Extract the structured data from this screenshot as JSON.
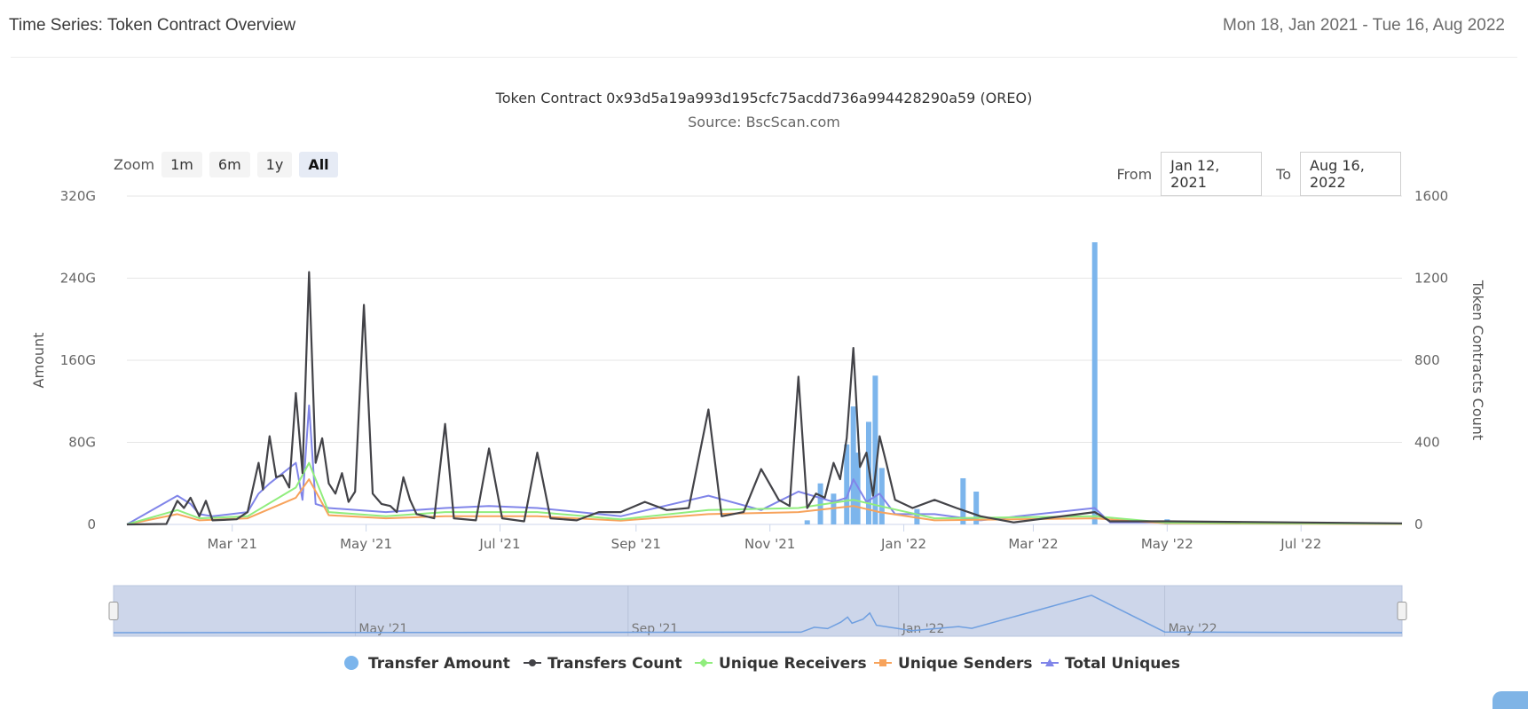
{
  "header": {
    "title": "Time Series: Token Contract Overview",
    "date_range": "Mon 18, Jan 2021 - Tue 16, Aug 2022"
  },
  "zoom": {
    "label": "Zoom",
    "buttons": [
      {
        "label": "1m",
        "active": false
      },
      {
        "label": "6m",
        "active": false
      },
      {
        "label": "1y",
        "active": false
      },
      {
        "label": "All",
        "active": true
      }
    ]
  },
  "range": {
    "from_label": "From",
    "from_value": "Jan 12, 2021",
    "to_label": "To",
    "to_value": "Aug 16, 2022"
  },
  "colors": {
    "transfer_amount": "#7cb5ec",
    "transfers_count": "#434348",
    "unique_receivers": "#90ed7d",
    "unique_senders": "#f7a35c",
    "total_uniques": "#8085e9",
    "navigator_fill": "#cdd6ea"
  },
  "chart_data": {
    "type": "line",
    "title": "Token Contract 0x93d5a19a993d195cfc75acdd736a994428290a59 (OREO)",
    "subtitle": "Source: BscScan.com",
    "x_range": [
      "2021-01-12",
      "2022-08-16"
    ],
    "y_left": {
      "label": "Amount",
      "ticks": [
        "0",
        "80G",
        "160G",
        "240G",
        "320G"
      ],
      "max": 320
    },
    "y_right": {
      "label": "Token Contracts Count",
      "ticks": [
        "0",
        "400",
        "800",
        "1200",
        "1600"
      ],
      "max": 1600
    },
    "x_ticks": [
      {
        "date": "2021-03-01",
        "label": "Mar '21"
      },
      {
        "date": "2021-05-01",
        "label": "May '21"
      },
      {
        "date": "2021-07-01",
        "label": "Jul '21"
      },
      {
        "date": "2021-09-01",
        "label": "Sep '21"
      },
      {
        "date": "2021-11-01",
        "label": "Nov '21"
      },
      {
        "date": "2022-01-01",
        "label": "Jan '22"
      },
      {
        "date": "2022-03-01",
        "label": "Mar '22"
      },
      {
        "date": "2022-05-01",
        "label": "May '22"
      },
      {
        "date": "2022-07-01",
        "label": "Jul '22"
      }
    ],
    "navigator_ticks": [
      {
        "date": "2021-05-01",
        "label": "May '21"
      },
      {
        "date": "2021-09-01",
        "label": "Sep '21"
      },
      {
        "date": "2022-01-01",
        "label": "Jan '22"
      },
      {
        "date": "2022-05-01",
        "label": "May '22"
      }
    ],
    "grid": true,
    "legend_position": "bottom-center",
    "series": [
      {
        "name": "Transfer Amount",
        "type": "column",
        "axis": "left",
        "unit": "G",
        "points": [
          [
            "2021-11-18",
            4
          ],
          [
            "2021-11-24",
            40
          ],
          [
            "2021-11-30",
            30
          ],
          [
            "2021-12-06",
            78
          ],
          [
            "2021-12-09",
            115
          ],
          [
            "2021-12-11",
            70
          ],
          [
            "2021-12-16",
            100
          ],
          [
            "2021-12-19",
            145
          ],
          [
            "2021-12-22",
            55
          ],
          [
            "2022-01-07",
            15
          ],
          [
            "2022-01-28",
            45
          ],
          [
            "2022-02-03",
            32
          ],
          [
            "2022-03-29",
            275
          ],
          [
            "2022-05-01",
            5
          ]
        ]
      },
      {
        "name": "Transfers Count",
        "type": "line",
        "axis": "right",
        "points": [
          [
            "2021-01-12",
            0
          ],
          [
            "2021-01-30",
            2
          ],
          [
            "2021-02-04",
            115
          ],
          [
            "2021-02-07",
            80
          ],
          [
            "2021-02-10",
            130
          ],
          [
            "2021-02-14",
            40
          ],
          [
            "2021-02-17",
            115
          ],
          [
            "2021-02-20",
            20
          ],
          [
            "2021-03-03",
            25
          ],
          [
            "2021-03-08",
            60
          ],
          [
            "2021-03-13",
            300
          ],
          [
            "2021-03-15",
            170
          ],
          [
            "2021-03-18",
            430
          ],
          [
            "2021-03-21",
            230
          ],
          [
            "2021-03-24",
            240
          ],
          [
            "2021-03-27",
            180
          ],
          [
            "2021-03-30",
            640
          ],
          [
            "2021-04-02",
            250
          ],
          [
            "2021-04-05",
            1230
          ],
          [
            "2021-04-08",
            300
          ],
          [
            "2021-04-11",
            420
          ],
          [
            "2021-04-14",
            200
          ],
          [
            "2021-04-17",
            150
          ],
          [
            "2021-04-20",
            250
          ],
          [
            "2021-04-23",
            110
          ],
          [
            "2021-04-26",
            160
          ],
          [
            "2021-04-30",
            1070
          ],
          [
            "2021-05-04",
            150
          ],
          [
            "2021-05-08",
            100
          ],
          [
            "2021-05-12",
            90
          ],
          [
            "2021-05-15",
            60
          ],
          [
            "2021-05-18",
            230
          ],
          [
            "2021-05-21",
            120
          ],
          [
            "2021-05-24",
            50
          ],
          [
            "2021-06-01",
            30
          ],
          [
            "2021-06-06",
            490
          ],
          [
            "2021-06-10",
            30
          ],
          [
            "2021-06-20",
            20
          ],
          [
            "2021-06-26",
            370
          ],
          [
            "2021-07-02",
            30
          ],
          [
            "2021-07-12",
            15
          ],
          [
            "2021-07-18",
            350
          ],
          [
            "2021-07-24",
            30
          ],
          [
            "2021-08-05",
            20
          ],
          [
            "2021-08-15",
            60
          ],
          [
            "2021-08-25",
            60
          ],
          [
            "2021-09-05",
            110
          ],
          [
            "2021-09-15",
            70
          ],
          [
            "2021-09-25",
            80
          ],
          [
            "2021-10-04",
            560
          ],
          [
            "2021-10-10",
            40
          ],
          [
            "2021-10-20",
            60
          ],
          [
            "2021-10-28",
            270
          ],
          [
            "2021-11-05",
            120
          ],
          [
            "2021-11-10",
            90
          ],
          [
            "2021-11-14",
            720
          ],
          [
            "2021-11-18",
            80
          ],
          [
            "2021-11-22",
            150
          ],
          [
            "2021-11-26",
            130
          ],
          [
            "2021-11-30",
            300
          ],
          [
            "2021-12-03",
            220
          ],
          [
            "2021-12-06",
            420
          ],
          [
            "2021-12-09",
            860
          ],
          [
            "2021-12-12",
            280
          ],
          [
            "2021-12-15",
            350
          ],
          [
            "2021-12-18",
            140
          ],
          [
            "2021-12-21",
            430
          ],
          [
            "2021-12-24",
            300
          ],
          [
            "2021-12-28",
            120
          ],
          [
            "2022-01-05",
            80
          ],
          [
            "2022-01-15",
            120
          ],
          [
            "2022-01-25",
            80
          ],
          [
            "2022-02-05",
            40
          ],
          [
            "2022-02-20",
            10
          ],
          [
            "2022-03-29",
            60
          ],
          [
            "2022-04-05",
            15
          ],
          [
            "2022-05-01",
            15
          ],
          [
            "2022-08-16",
            5
          ]
        ]
      },
      {
        "name": "Unique Receivers",
        "type": "line",
        "axis": "right",
        "points": [
          [
            "2021-01-12",
            0
          ],
          [
            "2021-02-04",
            70
          ],
          [
            "2021-02-14",
            30
          ],
          [
            "2021-03-08",
            40
          ],
          [
            "2021-03-30",
            180
          ],
          [
            "2021-04-05",
            300
          ],
          [
            "2021-04-14",
            60
          ],
          [
            "2021-05-10",
            40
          ],
          [
            "2021-06-06",
            60
          ],
          [
            "2021-07-18",
            60
          ],
          [
            "2021-08-25",
            25
          ],
          [
            "2021-10-04",
            70
          ],
          [
            "2021-11-14",
            80
          ],
          [
            "2021-12-09",
            120
          ],
          [
            "2021-12-21",
            90
          ],
          [
            "2022-01-15",
            30
          ],
          [
            "2022-03-29",
            40
          ],
          [
            "2022-05-01",
            8
          ],
          [
            "2022-08-16",
            3
          ]
        ]
      },
      {
        "name": "Unique Senders",
        "type": "line",
        "axis": "right",
        "points": [
          [
            "2021-01-12",
            0
          ],
          [
            "2021-02-04",
            50
          ],
          [
            "2021-02-14",
            20
          ],
          [
            "2021-03-08",
            30
          ],
          [
            "2021-03-30",
            130
          ],
          [
            "2021-04-05",
            220
          ],
          [
            "2021-04-14",
            45
          ],
          [
            "2021-05-10",
            30
          ],
          [
            "2021-06-06",
            40
          ],
          [
            "2021-07-18",
            40
          ],
          [
            "2021-08-25",
            18
          ],
          [
            "2021-10-04",
            50
          ],
          [
            "2021-11-14",
            60
          ],
          [
            "2021-12-09",
            90
          ],
          [
            "2021-12-21",
            60
          ],
          [
            "2022-01-15",
            20
          ],
          [
            "2022-03-29",
            30
          ],
          [
            "2022-05-01",
            5
          ],
          [
            "2022-08-16",
            2
          ]
        ]
      },
      {
        "name": "Total Uniques",
        "type": "line",
        "axis": "right",
        "points": [
          [
            "2021-01-12",
            0
          ],
          [
            "2021-02-04",
            140
          ],
          [
            "2021-02-10",
            100
          ],
          [
            "2021-02-14",
            50
          ],
          [
            "2021-02-20",
            40
          ],
          [
            "2021-03-08",
            60
          ],
          [
            "2021-03-13",
            150
          ],
          [
            "2021-03-18",
            200
          ],
          [
            "2021-03-30",
            300
          ],
          [
            "2021-04-02",
            120
          ],
          [
            "2021-04-05",
            580
          ],
          [
            "2021-04-08",
            100
          ],
          [
            "2021-04-14",
            80
          ],
          [
            "2021-05-10",
            60
          ],
          [
            "2021-06-06",
            80
          ],
          [
            "2021-06-26",
            90
          ],
          [
            "2021-07-18",
            80
          ],
          [
            "2021-08-25",
            40
          ],
          [
            "2021-10-04",
            140
          ],
          [
            "2021-10-28",
            70
          ],
          [
            "2021-11-14",
            160
          ],
          [
            "2021-11-30",
            110
          ],
          [
            "2021-12-06",
            130
          ],
          [
            "2021-12-09",
            220
          ],
          [
            "2021-12-15",
            110
          ],
          [
            "2021-12-21",
            150
          ],
          [
            "2021-12-28",
            50
          ],
          [
            "2022-01-15",
            50
          ],
          [
            "2022-02-05",
            20
          ],
          [
            "2022-03-29",
            80
          ],
          [
            "2022-04-05",
            10
          ],
          [
            "2022-05-01",
            10
          ],
          [
            "2022-08-16",
            4
          ]
        ]
      }
    ]
  }
}
